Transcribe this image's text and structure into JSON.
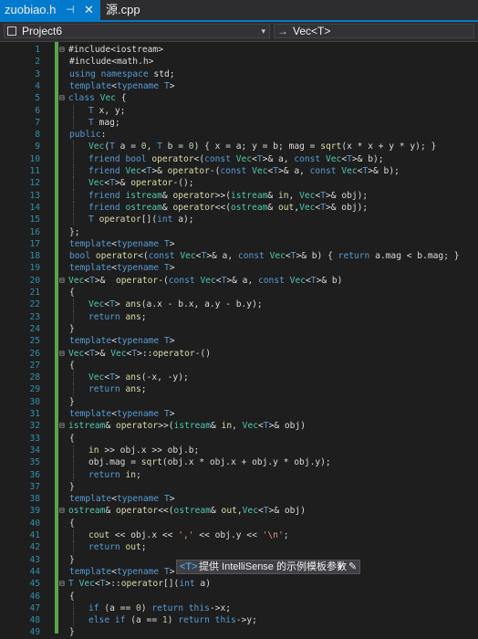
{
  "tabs": [
    {
      "label": "zuobiao.h",
      "pin": "⊣",
      "close": "✕"
    },
    {
      "label": "源.cpp"
    }
  ],
  "nav": {
    "project": "Project6",
    "member": "Vec<T>",
    "member_icon": "→"
  },
  "tooltip": {
    "token": "<T>",
    "text": "提供 IntelliSense 的示例模板参数",
    "dropdown": "▾",
    "pencil": "✎"
  },
  "code": [
    {
      "n": "1",
      "fold": "⊟",
      "text": "#include<iostream>"
    },
    {
      "n": "2",
      "fold": "",
      "text": "#include<math.h>"
    },
    {
      "n": "3",
      "fold": "",
      "text": "using namespace std;"
    },
    {
      "n": "4",
      "fold": "",
      "text": "template<typename T>"
    },
    {
      "n": "5",
      "fold": "⊟",
      "text": "class Vec {"
    },
    {
      "n": "6",
      "fold": "",
      "text": "T x, y;"
    },
    {
      "n": "7",
      "fold": "",
      "text": "T mag;"
    },
    {
      "n": "8",
      "fold": "",
      "text": "public:"
    },
    {
      "n": "9",
      "fold": "",
      "text": "Vec(T a = 0, T b = 0) { x = a; y = b; mag = sqrt(x * x + y * y); }"
    },
    {
      "n": "10",
      "fold": "",
      "text": "friend bool operator<(const Vec<T>& a, const Vec<T>& b);"
    },
    {
      "n": "11",
      "fold": "",
      "text": "friend Vec<T>& operator-(const Vec<T>& a, const Vec<T>& b);"
    },
    {
      "n": "12",
      "fold": "",
      "text": "Vec<T>& operator-();"
    },
    {
      "n": "13",
      "fold": "",
      "text": "friend istream& operator>>(istream& in, Vec<T>& obj);"
    },
    {
      "n": "14",
      "fold": "",
      "text": "friend ostream& operator<<(ostream& out,Vec<T>& obj);"
    },
    {
      "n": "15",
      "fold": "",
      "text": "T operator[](int a);"
    },
    {
      "n": "16",
      "fold": "",
      "text": "};"
    },
    {
      "n": "17",
      "fold": "",
      "text": "template<typename T>"
    },
    {
      "n": "18",
      "fold": "",
      "text": "bool operator<(const Vec<T>& a, const Vec<T>& b) { return a.mag < b.mag; }"
    },
    {
      "n": "19",
      "fold": "",
      "text": "template<typename T>"
    },
    {
      "n": "20",
      "fold": "⊟",
      "text": "Vec<T>&  operator-(const Vec<T>& a, const Vec<T>& b)"
    },
    {
      "n": "21",
      "fold": "",
      "text": "{"
    },
    {
      "n": "22",
      "fold": "",
      "text": "Vec<T> ans(a.x - b.x, a.y - b.y);"
    },
    {
      "n": "23",
      "fold": "",
      "text": "return ans;"
    },
    {
      "n": "24",
      "fold": "",
      "text": "}"
    },
    {
      "n": "25",
      "fold": "",
      "text": "template<typename T>"
    },
    {
      "n": "26",
      "fold": "⊟",
      "text": "Vec<T>& Vec<T>::operator-()"
    },
    {
      "n": "27",
      "fold": "",
      "text": "{"
    },
    {
      "n": "28",
      "fold": "",
      "text": "Vec<T> ans(-x, -y);"
    },
    {
      "n": "29",
      "fold": "",
      "text": "return ans;"
    },
    {
      "n": "30",
      "fold": "",
      "text": "}"
    },
    {
      "n": "31",
      "fold": "",
      "text": "template<typename T>"
    },
    {
      "n": "32",
      "fold": "⊟",
      "text": "istream& operator>>(istream& in, Vec<T>& obj)"
    },
    {
      "n": "33",
      "fold": "",
      "text": "{"
    },
    {
      "n": "34",
      "fold": "",
      "text": "in >> obj.x >> obj.b;"
    },
    {
      "n": "35",
      "fold": "",
      "text": "obj.mag = sqrt(obj.x * obj.x + obj.y * obj.y);"
    },
    {
      "n": "36",
      "fold": "",
      "text": "return in;"
    },
    {
      "n": "37",
      "fold": "",
      "text": "}"
    },
    {
      "n": "38",
      "fold": "",
      "text": "template<typename T>"
    },
    {
      "n": "39",
      "fold": "⊟",
      "text": "ostream& operator<<(ostream& out,Vec<T>& obj)"
    },
    {
      "n": "40",
      "fold": "",
      "text": "{"
    },
    {
      "n": "41",
      "fold": "",
      "text": "cout << obj.x << ',' << obj.y << '\\n';"
    },
    {
      "n": "42",
      "fold": "",
      "text": "return out;"
    },
    {
      "n": "43",
      "fold": "",
      "text": "}"
    },
    {
      "n": "44",
      "fold": "",
      "text": "template<typename T>"
    },
    {
      "n": "45",
      "fold": "⊟",
      "text": "T Vec<T>::operator[](int a)"
    },
    {
      "n": "46",
      "fold": "",
      "text": "{"
    },
    {
      "n": "47",
      "fold": "",
      "text": "if (a == 0) return this->x;"
    },
    {
      "n": "48",
      "fold": "",
      "text": "else if (a == 1) return this->y;"
    },
    {
      "n": "49",
      "fold": "",
      "text": "}"
    }
  ]
}
